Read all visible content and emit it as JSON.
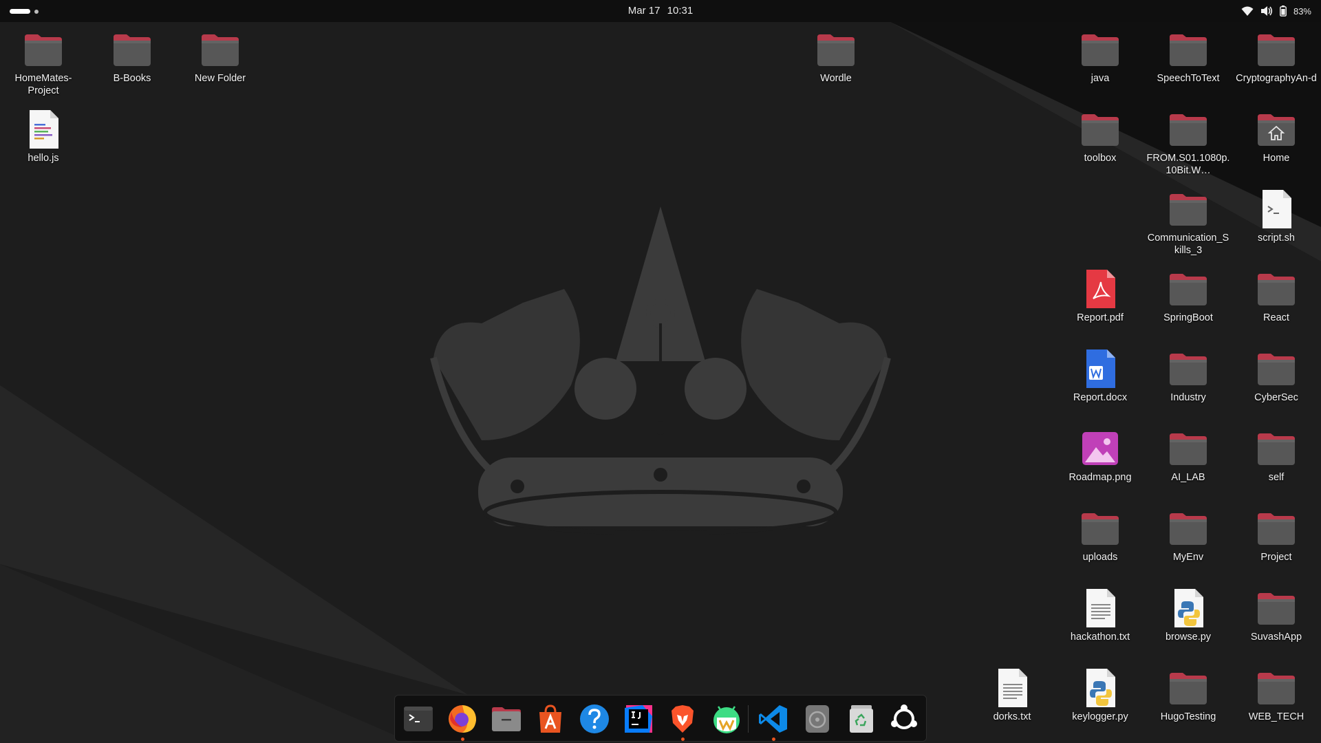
{
  "topbar": {
    "date": "Mar 17",
    "time": "10:31",
    "battery": "83%",
    "icons": [
      "activities-indicator",
      "wifi-icon",
      "volume-icon",
      "battery-icon"
    ]
  },
  "desktop": {
    "icons": [
      {
        "label": "HomeMates-Project",
        "type": "folder"
      },
      {
        "label": "B-Books",
        "type": "folder"
      },
      {
        "label": "New Folder",
        "type": "folder"
      },
      {
        "label": "hello.js",
        "type": "js-file"
      },
      {
        "label": "Wordle",
        "type": "folder"
      },
      {
        "label": "java",
        "type": "folder"
      },
      {
        "label": "SpeechToText",
        "type": "folder"
      },
      {
        "label": "CryptographyAn-d",
        "type": "folder"
      },
      {
        "label": "toolbox",
        "type": "folder"
      },
      {
        "label": "FROM.S01.1080p.10Bit.W…",
        "type": "folder"
      },
      {
        "label": "Home",
        "type": "home-folder"
      },
      {
        "label": "Communication_Skills_3",
        "type": "folder"
      },
      {
        "label": "script.sh",
        "type": "shell-script"
      },
      {
        "label": "Report.pdf",
        "type": "pdf"
      },
      {
        "label": "SpringBoot",
        "type": "folder"
      },
      {
        "label": "React",
        "type": "folder"
      },
      {
        "label": "Report.docx",
        "type": "docx"
      },
      {
        "label": "Industry",
        "type": "folder"
      },
      {
        "label": "CyberSec",
        "type": "folder"
      },
      {
        "label": "Roadmap.png",
        "type": "image"
      },
      {
        "label": "AI_LAB",
        "type": "folder"
      },
      {
        "label": "self",
        "type": "folder"
      },
      {
        "label": "uploads",
        "type": "folder"
      },
      {
        "label": "MyEnv",
        "type": "folder"
      },
      {
        "label": "Project",
        "type": "folder"
      },
      {
        "label": "hackathon.txt",
        "type": "text"
      },
      {
        "label": "browse.py",
        "type": "python"
      },
      {
        "label": "SuvashApp",
        "type": "folder"
      },
      {
        "label": "dorks.txt",
        "type": "text"
      },
      {
        "label": "keylogger.py",
        "type": "python"
      },
      {
        "label": "HugoTesting",
        "type": "folder"
      },
      {
        "label": "WEB_TECH",
        "type": "folder"
      }
    ]
  },
  "dock": {
    "items": [
      {
        "app": "terminal",
        "running": false
      },
      {
        "app": "firefox",
        "running": true
      },
      {
        "app": "files",
        "running": false
      },
      {
        "app": "app-center",
        "running": false
      },
      {
        "app": "help",
        "running": false
      },
      {
        "app": "intellij-idea",
        "running": false
      },
      {
        "app": "brave",
        "running": true
      },
      {
        "app": "android-studio",
        "running": false
      },
      {
        "app": "vscode",
        "running": true
      },
      {
        "app": "disks",
        "running": false
      },
      {
        "app": "trash",
        "running": false
      },
      {
        "app": "show-apps",
        "running": false
      }
    ]
  },
  "colors": {
    "folder_top": "#b83a4b",
    "folder_body": "#575757",
    "panel": "#0f0f0f",
    "accent": "#e95420"
  }
}
